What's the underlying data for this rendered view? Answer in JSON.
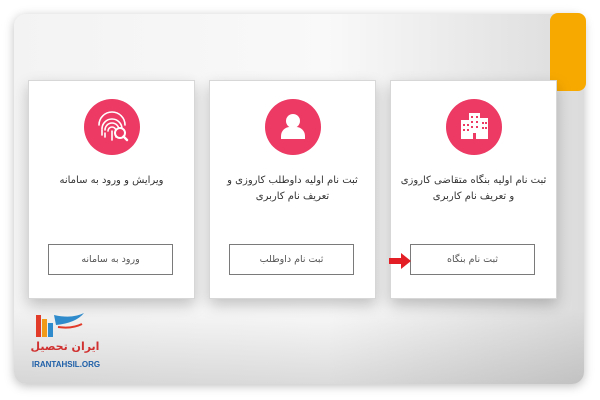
{
  "colors": {
    "accent": "#ec3a64",
    "tab": "#f8a900",
    "arrow": "#e31e24"
  },
  "cards": [
    {
      "icon": "fingerprint-search-icon",
      "text": "ویرایش و ورود به سامانه",
      "button": "ورود به سامانه"
    },
    {
      "icon": "user-icon",
      "text": "ثبت نام اولیه داوطلب کاروزی و تعریف نام کاربری",
      "button": "ثبت نام داوطلب"
    },
    {
      "icon": "building-icon",
      "text": "ثبت نام اولیه بنگاه متقاضی کاروزی و تعریف نام کاربری",
      "button": "ثبت نام بنگاه"
    }
  ],
  "watermark": {
    "name": "ایران تحصیل",
    "url": "IRANTAHSIL.ORG"
  }
}
